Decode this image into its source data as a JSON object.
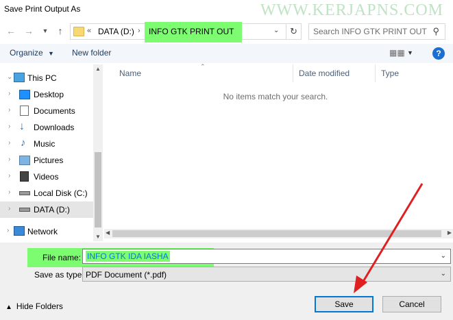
{
  "window": {
    "title": "Save Print Output As",
    "watermark": "WWW.KERJAPNS.COM"
  },
  "nav": {
    "back_icon": "arrow-left-icon",
    "forward_icon": "arrow-right-icon",
    "recent_icon": "chevron-down-icon",
    "up_icon": "arrow-up-icon",
    "breadcrumb_overflow": "«",
    "breadcrumb": [
      "DATA (D:)",
      "INFO GTK PRINT OUT"
    ],
    "search_placeholder": "Search INFO GTK PRINT OUT"
  },
  "toolbar": {
    "organize": "Organize",
    "new_folder": "New folder"
  },
  "sidebar": {
    "items": [
      {
        "label": "This PC",
        "icon": "computer-icon"
      },
      {
        "label": "Desktop",
        "icon": "desktop-icon"
      },
      {
        "label": "Documents",
        "icon": "documents-icon"
      },
      {
        "label": "Downloads",
        "icon": "download-icon"
      },
      {
        "label": "Music",
        "icon": "music-icon"
      },
      {
        "label": "Pictures",
        "icon": "pictures-icon"
      },
      {
        "label": "Videos",
        "icon": "videos-icon"
      },
      {
        "label": "Local Disk (C:)",
        "icon": "drive-icon"
      },
      {
        "label": "DATA (D:)",
        "icon": "drive-icon"
      },
      {
        "label": "Network",
        "icon": "network-icon"
      }
    ]
  },
  "files": {
    "columns": [
      "Name",
      "Date modified",
      "Type"
    ],
    "empty_message": "No items match your search."
  },
  "form": {
    "file_name_label": "File name:",
    "file_name_value": "INFO GTK IDA IASHA",
    "save_as_type_label": "Save as type:",
    "save_as_type_value": "PDF Document (*.pdf)"
  },
  "footer": {
    "hide_folders": "Hide Folders",
    "save": "Save",
    "cancel": "Cancel"
  },
  "colors": {
    "highlight": "#7dfc72",
    "accent": "#0078d7",
    "arrow": "#e02020"
  }
}
